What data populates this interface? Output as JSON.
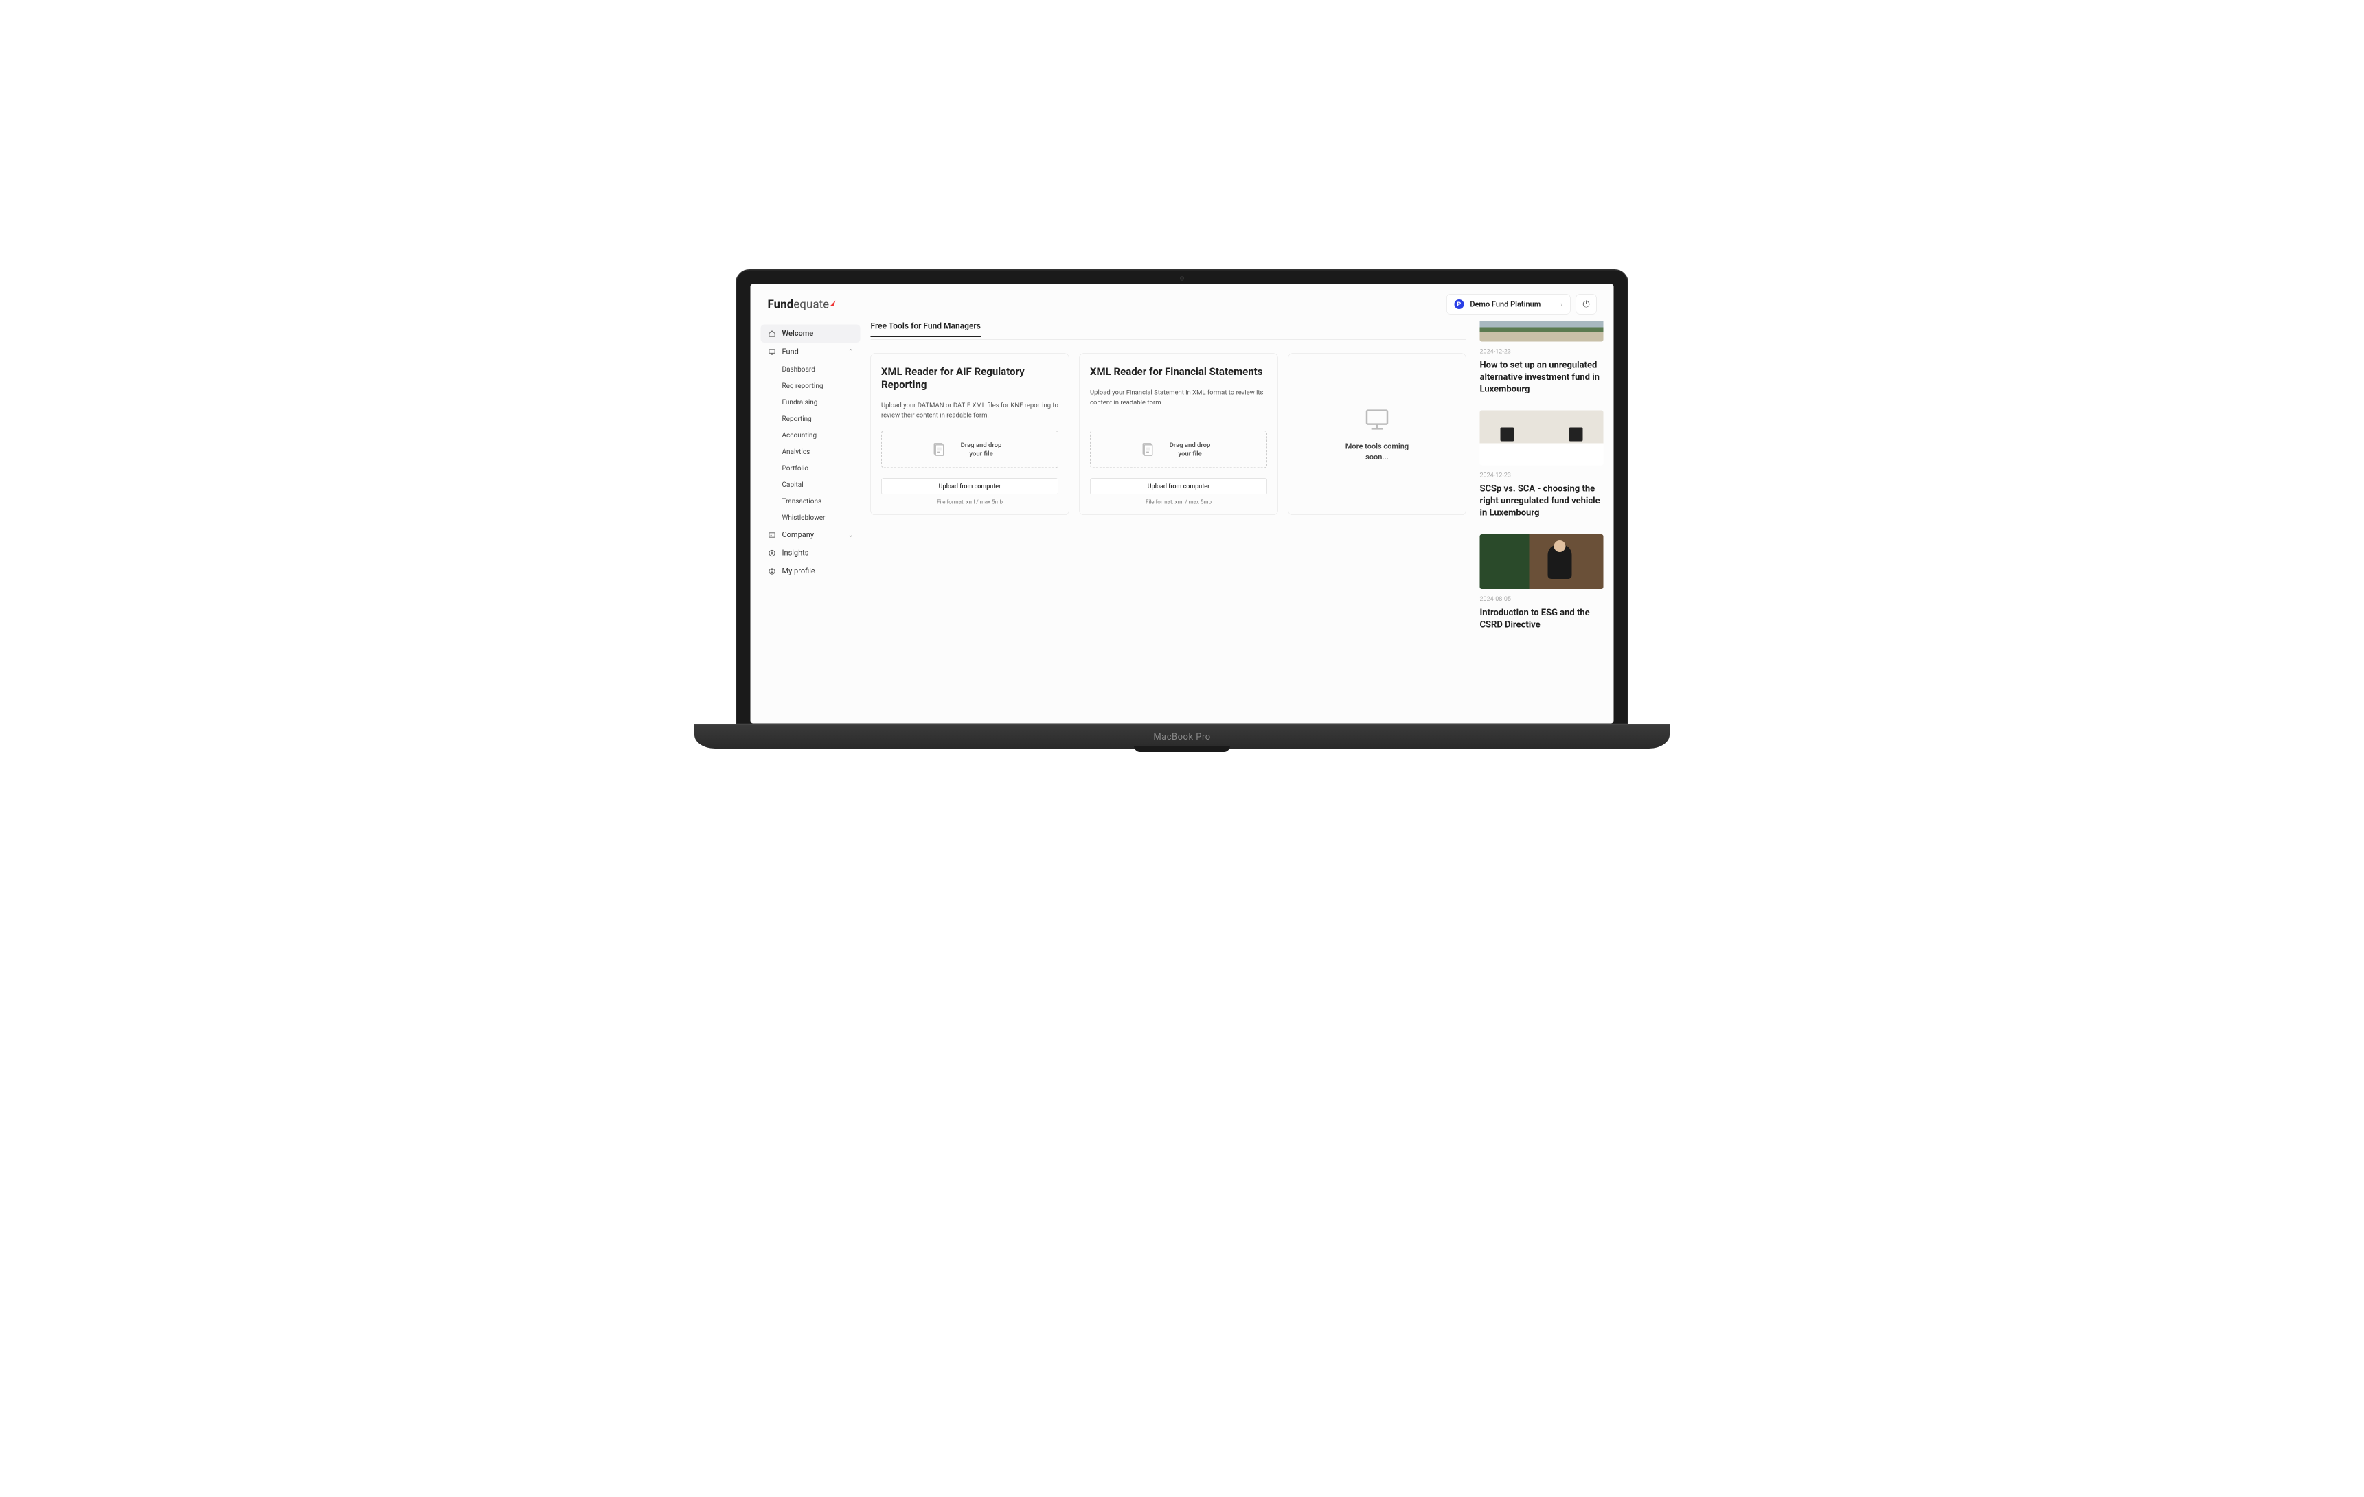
{
  "brand": {
    "part1": "Fund",
    "part2": "equate"
  },
  "header": {
    "fund_selector_label": "Demo Fund Platinum",
    "fund_badge_letter": "P"
  },
  "sidebar": {
    "welcome": "Welcome",
    "fund": "Fund",
    "fund_children": [
      "Dashboard",
      "Reg reporting",
      "Fundraising",
      "Reporting",
      "Accounting",
      "Analytics",
      "Portfolio",
      "Capital",
      "Transactions",
      "Whistleblower"
    ],
    "company": "Company",
    "insights": "Insights",
    "my_profile": "My profile"
  },
  "main": {
    "section_title": "Free Tools for Fund Managers",
    "tools": [
      {
        "title": "XML Reader for AIF Regulatory Reporting",
        "desc": "Upload your DATMAN or DATIF XML files for KNF reporting to review their content in readable form.",
        "dropzone": "Drag and drop your file",
        "upload_btn": "Upload from computer",
        "file_format": "File format: xml / max 5mb"
      },
      {
        "title": "XML Reader for Financial Statements",
        "desc": "Upload your Financial Statement in XML format to review its content in readable form.",
        "dropzone": "Drag and drop your file",
        "upload_btn": "Upload from computer",
        "file_format": "File format: xml / max 5mb"
      }
    ],
    "coming_soon": "More tools coming soon..."
  },
  "articles": [
    {
      "date": "2024-12-23",
      "title": "How to set up an unregulated alternative investment fund in Luxembourg"
    },
    {
      "date": "2024-12-23",
      "title": "SCSp vs. SCA - choosing the right unregulated fund vehicle in Luxembourg"
    },
    {
      "date": "2024-08-05",
      "title": "Introduction to ESG and the CSRD Directive"
    }
  ],
  "device_label": "MacBook Pro"
}
